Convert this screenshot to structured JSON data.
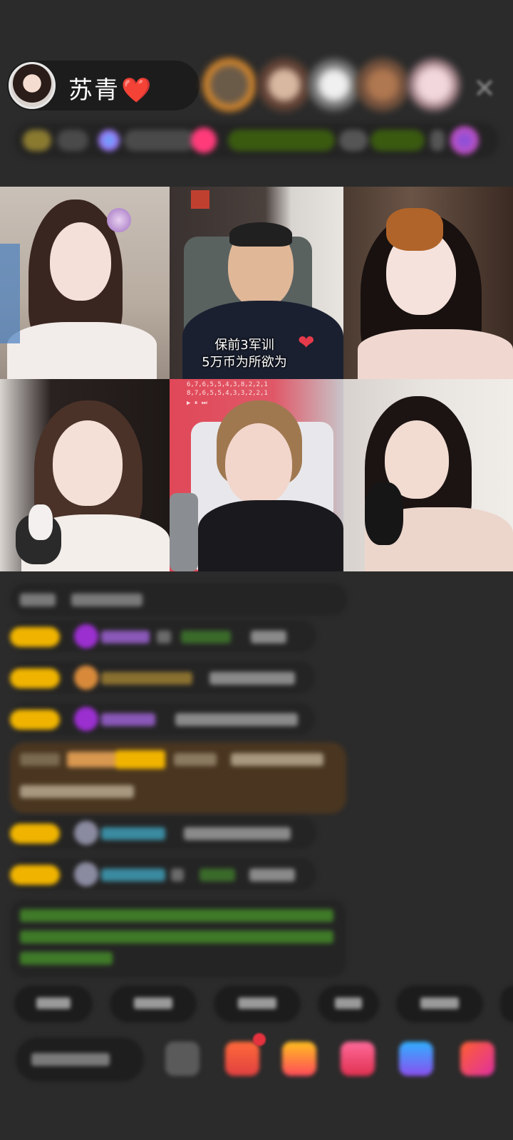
{
  "host": {
    "name": "苏青",
    "heart": "❤️"
  },
  "close_icon": "✕",
  "video_grid": {
    "overlay_caption_line1": "保前3军训",
    "overlay_caption_line2": "5万币为所欲为",
    "overlay_heart": "❤",
    "music_line1": "6,7,6,5,5,4,3,8,2,2,1",
    "music_line2": "8,7,6,5,5,4,3,3,2,2,1"
  },
  "colors": {
    "background": "#2b2b2b",
    "badge_gold": "#f0b400",
    "vip_purple": "#9b2fd0",
    "green_text": "#4fd04f",
    "system_brown": "#4a3620"
  }
}
